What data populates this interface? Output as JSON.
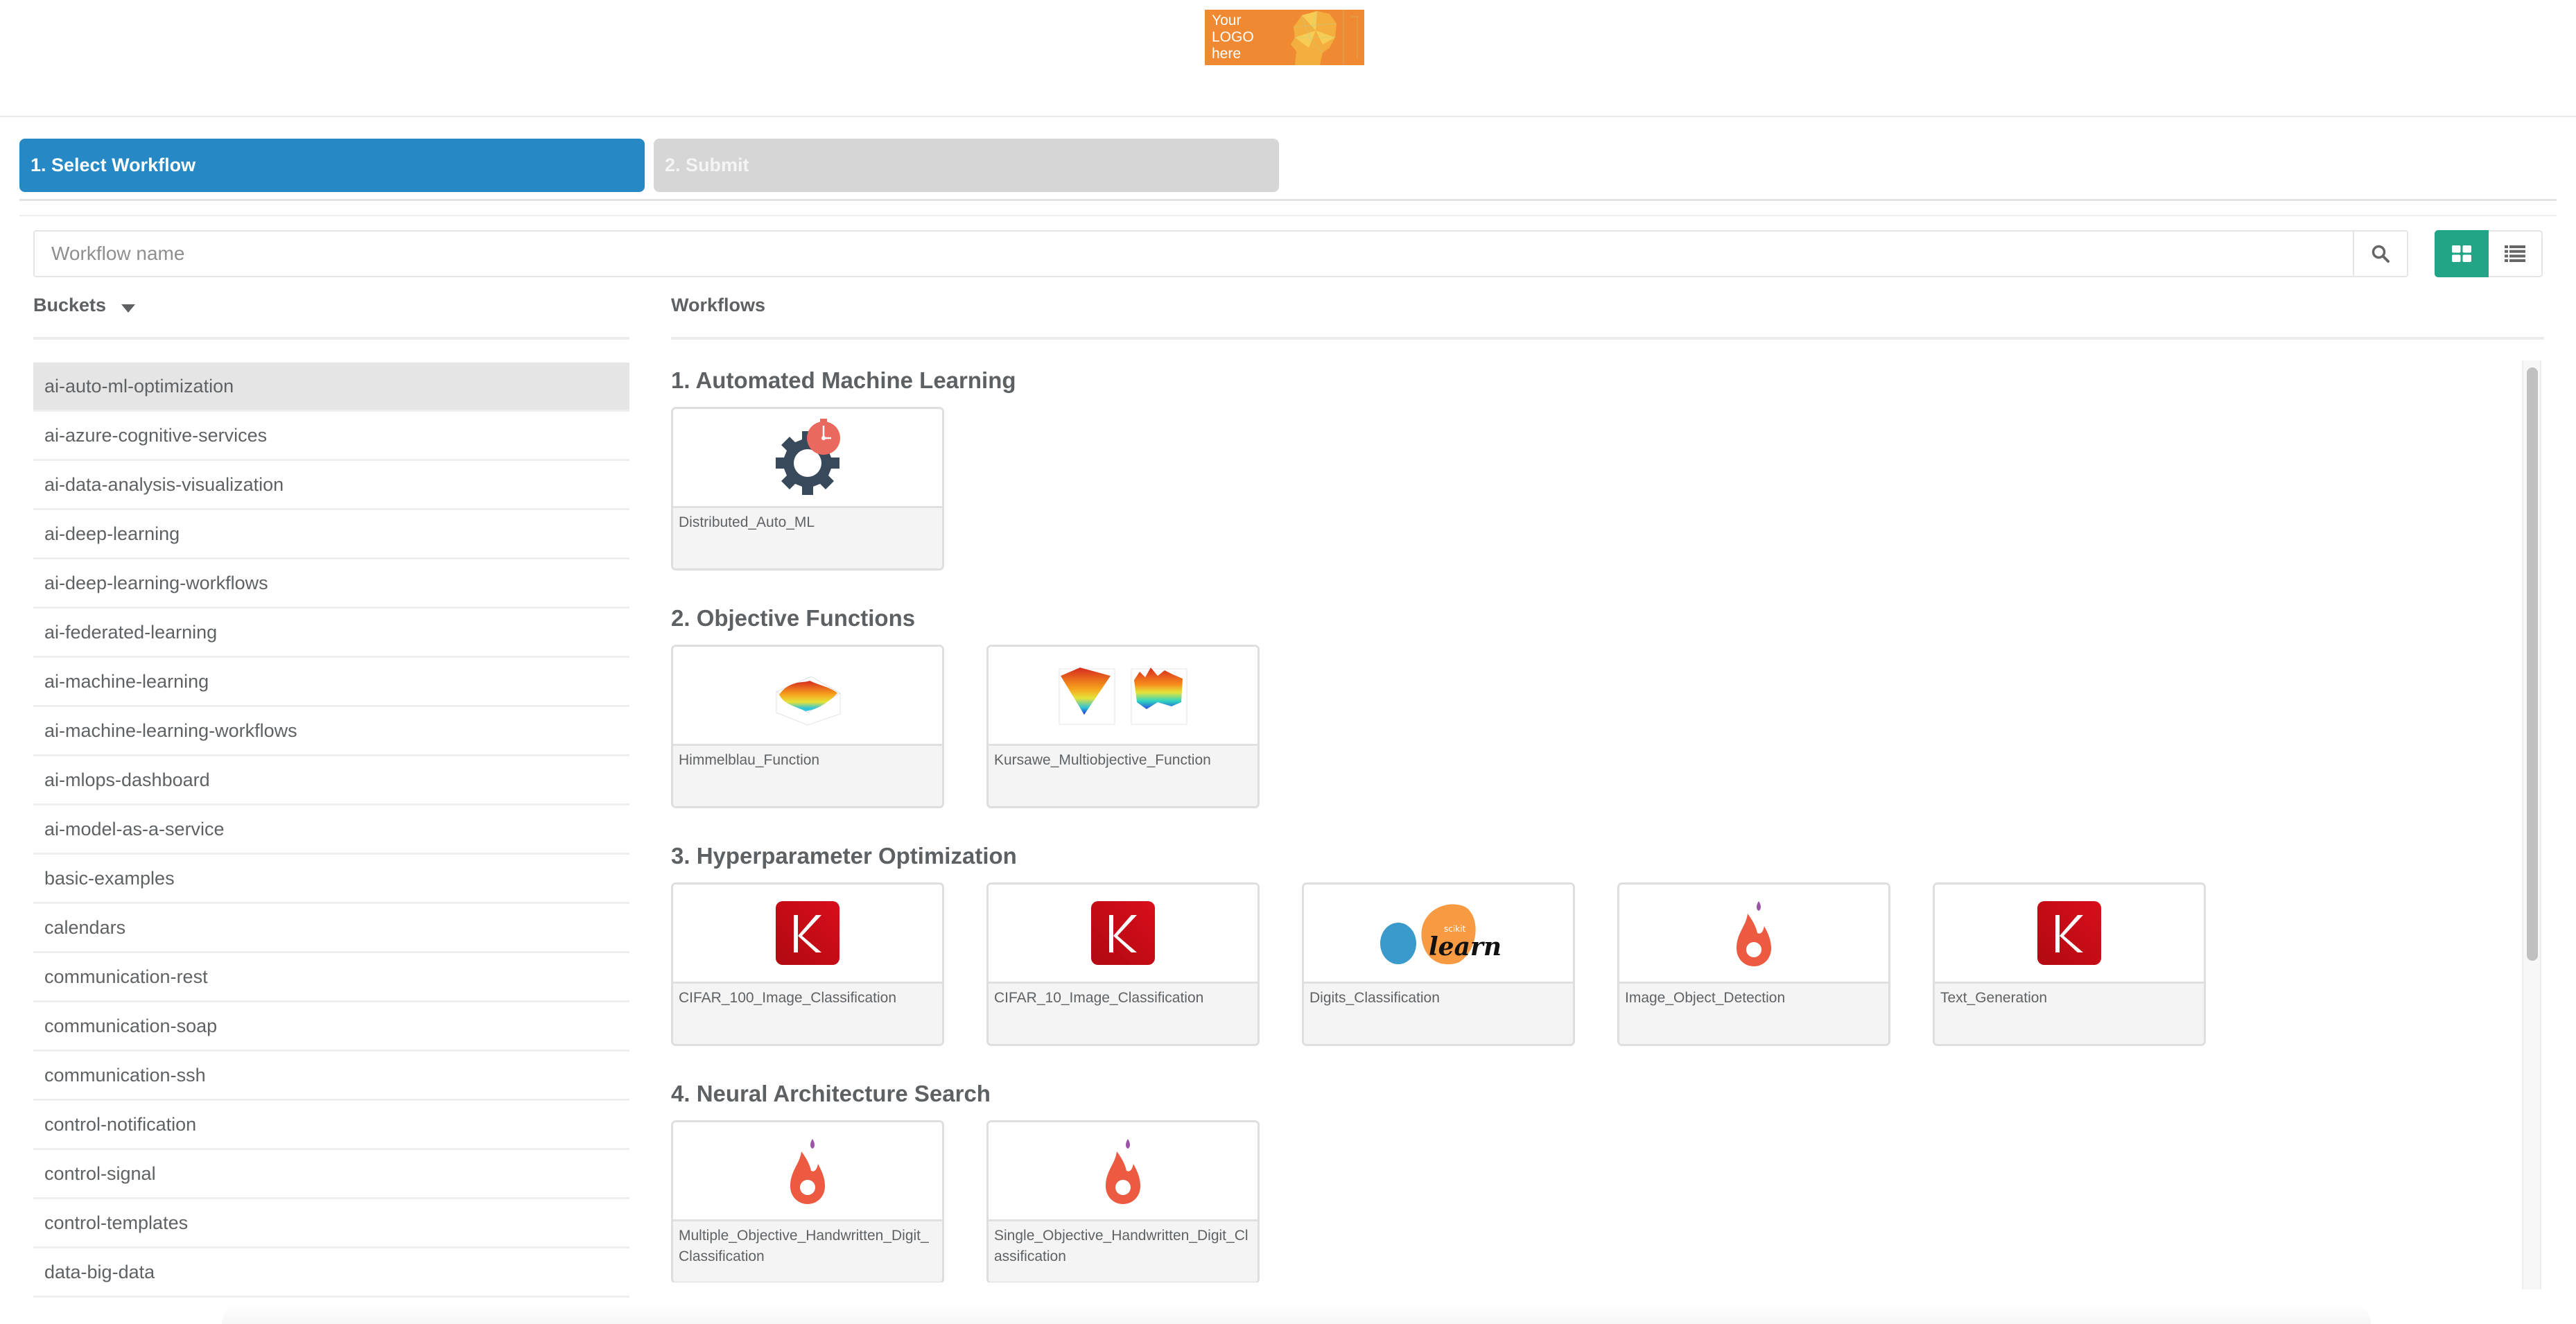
{
  "header": {
    "logo": {
      "lines": [
        "Your",
        "LOGO",
        "here"
      ],
      "color": "#ef8a33"
    }
  },
  "steps": [
    {
      "label": "1. Select Workflow",
      "state": "active",
      "color": "#2688c4"
    },
    {
      "label": "2. Submit",
      "state": "inactive",
      "color": "#d6d6d6"
    }
  ],
  "search": {
    "placeholder": "Workflow name",
    "value": "",
    "button_icon": "search-icon"
  },
  "view_toggle": {
    "options": [
      {
        "name": "grid-view",
        "icon": "grid-icon",
        "active": true
      },
      {
        "name": "list-view",
        "icon": "list-icon",
        "active": false
      }
    ],
    "active_color": "#22a587"
  },
  "buckets": {
    "title": "Buckets",
    "selected": "ai-auto-ml-optimization",
    "items": [
      "ai-auto-ml-optimization",
      "ai-azure-cognitive-services",
      "ai-data-analysis-visualization",
      "ai-deep-learning",
      "ai-deep-learning-workflows",
      "ai-federated-learning",
      "ai-machine-learning",
      "ai-machine-learning-workflows",
      "ai-mlops-dashboard",
      "ai-model-as-a-service",
      "basic-examples",
      "calendars",
      "communication-rest",
      "communication-soap",
      "communication-ssh",
      "control-notification",
      "control-signal",
      "control-templates",
      "data-big-data"
    ]
  },
  "workflows": {
    "title": "Workflows",
    "sections": [
      {
        "title": "1. Automated Machine Learning",
        "cards": [
          {
            "label": "Distributed_Auto_ML",
            "icon": "gear-stopwatch-icon"
          }
        ]
      },
      {
        "title": "2. Objective Functions",
        "cards": [
          {
            "label": "Himmelblau_Function",
            "icon": "surface-plot-icon"
          },
          {
            "label": "Kursawe_Multiobjective_Function",
            "icon": "double-surface-plot-icon"
          }
        ]
      },
      {
        "title": "3. Hyperparameter Optimization",
        "cards": [
          {
            "label": "CIFAR_100_Image_Classification",
            "icon": "keras-icon"
          },
          {
            "label": "CIFAR_10_Image_Classification",
            "icon": "keras-icon"
          },
          {
            "label": "Digits_Classification",
            "icon": "scikit-learn-icon"
          },
          {
            "label": "Image_Object_Detection",
            "icon": "flame-icon"
          },
          {
            "label": "Text_Generation",
            "icon": "keras-icon"
          }
        ]
      },
      {
        "title": "4. Neural Architecture Search",
        "cards": [
          {
            "label": "Multiple_Objective_Handwritten_Digit_Classification",
            "icon": "flame-icon"
          },
          {
            "label": "Single_Objective_Handwritten_Digit_Classification",
            "icon": "flame-icon"
          }
        ]
      }
    ]
  }
}
